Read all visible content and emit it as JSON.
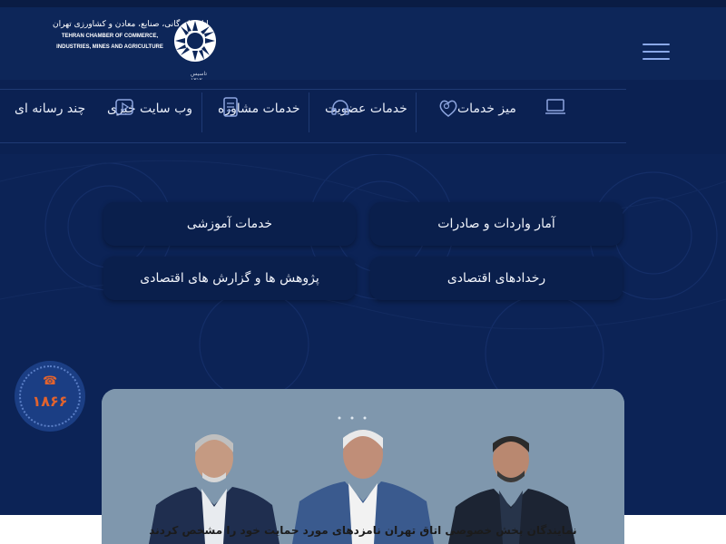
{
  "header": {
    "logo_fa": "اتاق بازرگانی، صنایع، معادن و کشاورزی تهران",
    "logo_en_1": "TEHRAN CHAMBER OF COMMERCE,",
    "logo_en_2": "INDUSTRIES, MINES AND AGRICULTURE",
    "logo_year": "تاسیس ۱۳۱۲",
    "menu_icon": "hamburger-icon"
  },
  "nav": {
    "items": [
      {
        "label": "میز خدمات",
        "icon": "laptop-icon"
      },
      {
        "label": "خدمات عضویت",
        "icon": "user-heart-icon"
      },
      {
        "label": "خدمات مشاوره",
        "icon": "headset-icon"
      },
      {
        "label": "وب سایت خبری",
        "icon": "document-icon"
      },
      {
        "label": "چند رسانه ای",
        "icon": "play-icon"
      }
    ]
  },
  "cards": [
    {
      "label": "آمار واردات و صادرات"
    },
    {
      "label": "خدمات آموزشی"
    },
    {
      "label": "رخدادهای اقتصادی"
    },
    {
      "label": "پژوهش ها و گزارش های اقتصادی"
    }
  ],
  "phone": {
    "number": "۱۸۶۶",
    "icon": "phone-icon"
  },
  "news": {
    "caption": "نمایندگان بخش خصوصی اتاق تهران نامزدهای مورد حمایت خود را مشخص کردند"
  },
  "colors": {
    "background": "#0c2356",
    "accent": "#e2632e",
    "card": "#0a1f4c"
  }
}
